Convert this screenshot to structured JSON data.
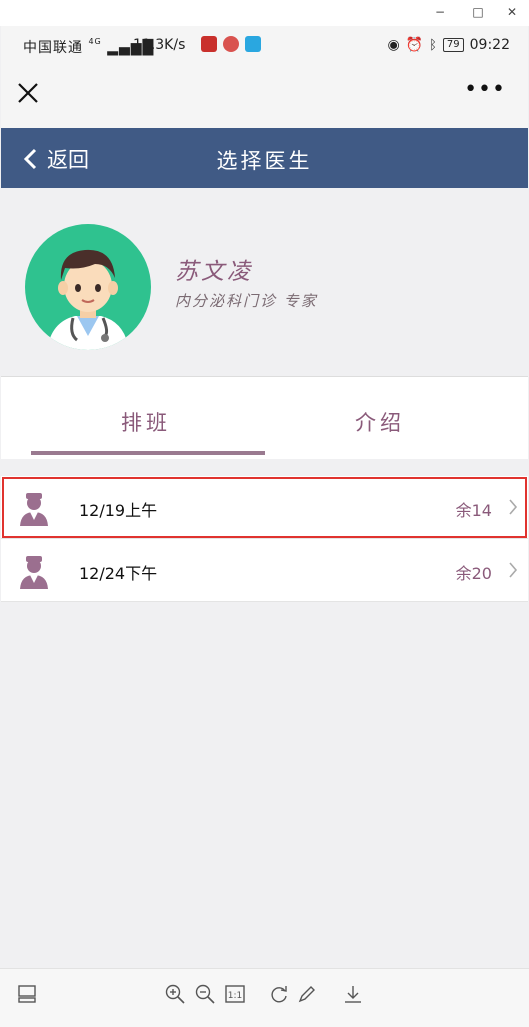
{
  "window": {
    "minimize": "−",
    "maximize": "□",
    "close": "✕"
  },
  "statusbar": {
    "carrier": "中国联通",
    "network": "4G",
    "speed": "11.3K/s",
    "battery": "79",
    "time": "09:22"
  },
  "nav": {
    "back_label": "返回",
    "title": "选择医生"
  },
  "doctor": {
    "name": "苏文凌",
    "title": "内分泌科门诊 专家"
  },
  "tabs": [
    {
      "label": "排班",
      "active": true
    },
    {
      "label": "介绍",
      "active": false
    }
  ],
  "schedule": [
    {
      "date": "12/19上午",
      "remaining": "余14",
      "highlighted": true
    },
    {
      "date": "12/24下午",
      "remaining": "余20",
      "highlighted": false
    }
  ],
  "colors": {
    "nav_bg": "#405a85",
    "accent": "#8a5a7a",
    "avatar_bg": "#2fc28f",
    "highlight": "#e0332f"
  }
}
